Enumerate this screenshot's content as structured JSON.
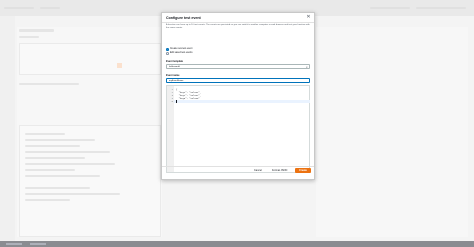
{
  "modal": {
    "title": "Configure test event",
    "close_icon": "close-icon",
    "description": "A function can have up to 10 test events. The events are persisted so you can switch to another computer or web browser and test your function with the same events.",
    "options": [
      {
        "label": "Create new test event",
        "selected": true
      },
      {
        "label": "Edit saved test events",
        "selected": false
      }
    ],
    "event_template_label": "Event template",
    "event_template_value": "hello-world",
    "event_name_label": "Event name",
    "event_name_value": "myEventName",
    "editor": {
      "line_numbers": [
        "1",
        "2",
        "3",
        "4",
        "5"
      ],
      "lines": [
        "{",
        "  \"key1\": \"value1\",",
        "  \"key2\": \"value2\",",
        "  \"key3\": \"value3\"",
        "}"
      ]
    },
    "buttons": {
      "cancel": "Cancel",
      "format_json": "Format JSON",
      "create": "Create"
    }
  },
  "colors": {
    "accent": "#0073bb",
    "primary_button": "#ec7211"
  }
}
